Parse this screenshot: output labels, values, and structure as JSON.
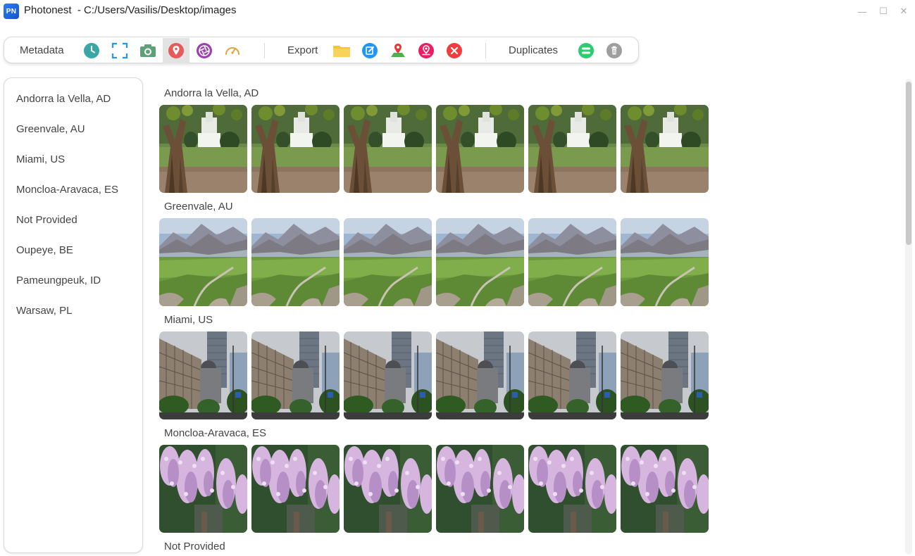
{
  "window": {
    "app_icon_text": "PN",
    "title": "Photonest  - C:/Users/Vasilis/Desktop/images",
    "minimize_glyph": "—",
    "maximize_glyph": "☐",
    "close_glyph": "✕"
  },
  "toolbar": {
    "metadata_label": "Metadata",
    "export_label": "Export",
    "duplicates_label": "Duplicates",
    "metadata_buttons": [
      "clock-icon",
      "crop-frame-icon",
      "camera-icon",
      "location-pin-icon",
      "aperture-icon",
      "speedometer-icon"
    ],
    "export_buttons": [
      "folder-icon",
      "edit-icon",
      "map-pin-icon",
      "pin-location-icon",
      "close-circle-icon"
    ],
    "duplicates_buttons": [
      "duplicates-icon",
      "trash-icon"
    ],
    "active_button": "location-pin-icon",
    "colors": {
      "teal": "#3ba6a6",
      "blue": "#2196f3",
      "green": "#4caf50",
      "red": "#e53935",
      "pink": "#e91e63",
      "purple": "#9c27b0",
      "orange": "#e6a23c",
      "yellow": "#f7c431",
      "emerald": "#2ecc71",
      "gray": "#9e9e9e"
    }
  },
  "sidebar": {
    "items": [
      {
        "label": "Andorra la Vella, AD"
      },
      {
        "label": "Greenvale, AU"
      },
      {
        "label": "Miami, US"
      },
      {
        "label": "Moncloa-Aravaca, ES"
      },
      {
        "label": "Not Provided"
      },
      {
        "label": "Oupeye, BE"
      },
      {
        "label": "Pameungpeuk, ID"
      },
      {
        "label": "Warsaw, PL"
      }
    ]
  },
  "gallery": {
    "groups": [
      {
        "label": "Andorra la Vella, AD",
        "scene": "park-tree",
        "count": 6
      },
      {
        "label": "Greenvale, AU",
        "scene": "mountain-valley",
        "count": 6
      },
      {
        "label": "Miami, US",
        "scene": "city-buildings",
        "count": 6
      },
      {
        "label": "Moncloa-Aravaca, ES",
        "scene": "wisteria-flowers",
        "count": 6
      },
      {
        "label": "Not Provided",
        "scene": "none",
        "count": 0
      }
    ]
  }
}
